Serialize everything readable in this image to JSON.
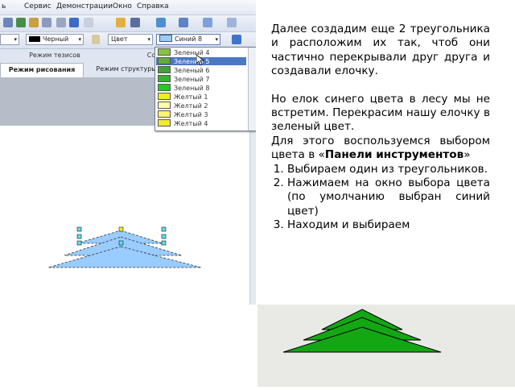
{
  "menubar": {
    "items": [
      "ь",
      "Сервис",
      "Демонстрации",
      "Окно",
      "Справка"
    ]
  },
  "toolbar2": {
    "line_color_label": "Черный",
    "line_style_label": "Цвет",
    "fill_color_label": "Синий 8"
  },
  "tabs_top": {
    "left_tab": "Режим тезисов",
    "right_tab_partial": "Со"
  },
  "tabs": {
    "drawing": "Режим рисования",
    "structure": "Режим структуры"
  },
  "color_dropdown": {
    "items": [
      {
        "label": "Зеленый 4",
        "color": "#86c440"
      },
      {
        "label": "Зеленый 5",
        "color": "#5fae3a",
        "selected": true
      },
      {
        "label": "Зеленый 6",
        "color": "#3fa33a"
      },
      {
        "label": "Зеленый 7",
        "color": "#2fb52f"
      },
      {
        "label": "Зеленый 8",
        "color": "#22cc22"
      },
      {
        "label": "Желтый 1",
        "color": "#eaf21a"
      },
      {
        "label": "Желтый 2",
        "color": "#ffffa8"
      },
      {
        "label": "Желтый 3",
        "color": "#fbf46e"
      },
      {
        "label": "Желтый 4",
        "color": "#f2ea32"
      }
    ]
  },
  "tree_colors": {
    "blue_fill": "#99ccff",
    "green_fill": "#13a813"
  },
  "text": {
    "p1": "Далее создадим еще 2 треугольника и расположим их так, чтоб они частично перекрывали друг друга и создавали елочку.",
    "p2": "Но елок синего цвета в лесу мы не встретим. Перекрасим нашу елочку в зеленый цвет.",
    "p3_before": "Для этого воспользуемся выбором цвета в «",
    "p3_bold": "Панели инструментов",
    "p3_after": "»",
    "steps": [
      "Выбираем один из треугольников.",
      "Нажимаем на окно выбора цвета (по умолчанию выбран синий цвет)",
      "Находим и выбираем"
    ]
  }
}
